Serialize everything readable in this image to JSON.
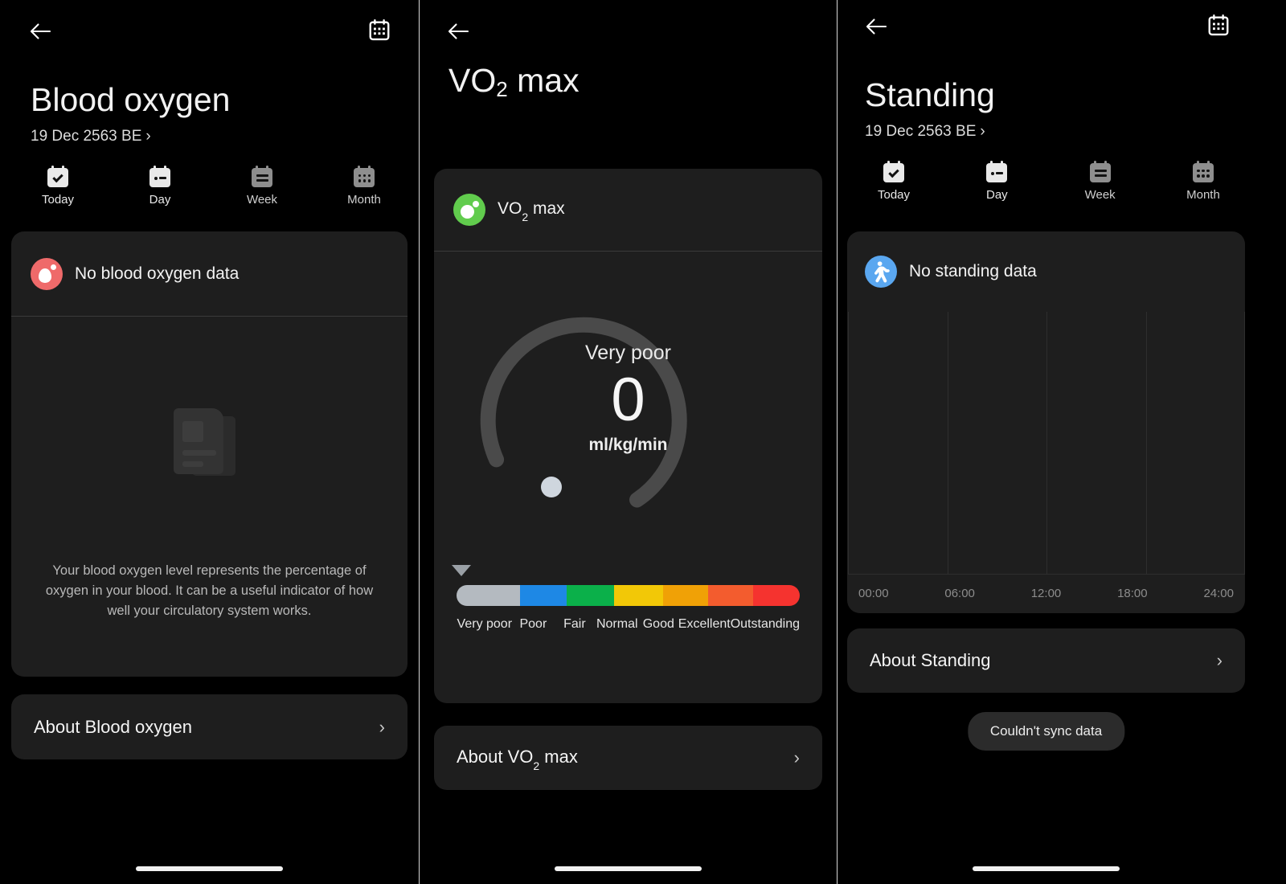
{
  "colors": {
    "background": "#000000",
    "card": "#1e1e1e",
    "accent_blood_oxygen": "#ef6a6a",
    "accent_vo2": "#61cc4d",
    "accent_standing": "#5aa7f0",
    "gauge_track": "#4a4a4a",
    "gauge_knob": "#cfd6de"
  },
  "tabs": [
    {
      "label": "Today",
      "icon": "calendar-check-icon",
      "active": true
    },
    {
      "label": "Day",
      "icon": "calendar-day-icon",
      "active": true
    },
    {
      "label": "Week",
      "icon": "calendar-week-icon",
      "active": false
    },
    {
      "label": "Month",
      "icon": "calendar-month-icon",
      "active": false
    }
  ],
  "panel_blood_oxygen": {
    "back_icon": "back-arrow-icon",
    "calendar_icon": "calendar-icon",
    "title": "Blood oxygen",
    "date": "19 Dec 2563 BE",
    "date_chevron": "›",
    "card": {
      "icon": "blood-drop-icon",
      "status": "No blood oxygen data",
      "illustration": "empty-document-icon",
      "description": "Your blood oxygen level represents the percentage of oxygen in your blood. It can be a useful indicator of how well your circulatory system works."
    },
    "about": {
      "label": "About Blood oxygen",
      "chevron": "›"
    }
  },
  "panel_vo2max": {
    "back_icon": "back-arrow-icon",
    "calendar_icon": "calendar-icon",
    "title_main": "VO",
    "title_sub": "2",
    "title_tail": " max",
    "card": {
      "icon": "vo2-bubble-icon",
      "head_main": "VO",
      "head_sub": "2",
      "head_tail": " max",
      "gauge": {
        "rating": "Very poor",
        "value": "0",
        "unit": "ml/kg/min",
        "marker_icon": "triangle-down-icon"
      },
      "scale": [
        {
          "label": "Very poor",
          "color": "#b4bac0"
        },
        {
          "label": "Poor",
          "color": "#1e88e5"
        },
        {
          "label": "Fair",
          "color": "#0bb04a"
        },
        {
          "label": "Normal",
          "color": "#f2c807"
        },
        {
          "label": "Good",
          "color": "#f0a106"
        },
        {
          "label": "Excellent",
          "color": "#f35c2e"
        },
        {
          "label": "Outstanding",
          "color": "#f5332f"
        }
      ]
    },
    "about": {
      "label_main": "About VO",
      "label_sub": "2",
      "label_tail": " max",
      "chevron": "›"
    }
  },
  "panel_standing": {
    "back_icon": "back-arrow-icon",
    "calendar_icon": "calendar-icon",
    "title": "Standing",
    "date": "19 Dec 2563 BE",
    "date_chevron": "›",
    "card": {
      "icon": "standing-person-icon",
      "status": "No standing data"
    },
    "about": {
      "label": "About Standing",
      "chevron": "›"
    },
    "toast": "Couldn't sync data",
    "chart_data": {
      "type": "bar",
      "title": "No standing data",
      "categories": [
        "00:00",
        "06:00",
        "12:00",
        "18:00",
        "24:00"
      ],
      "values": [
        0,
        0,
        0,
        0,
        0
      ],
      "xlabel": "",
      "ylabel": "",
      "xticks": [
        "00:00",
        "06:00",
        "12:00",
        "18:00",
        "24:00"
      ],
      "grid": true,
      "gridlines_vertical": 5,
      "legend": "none"
    }
  }
}
